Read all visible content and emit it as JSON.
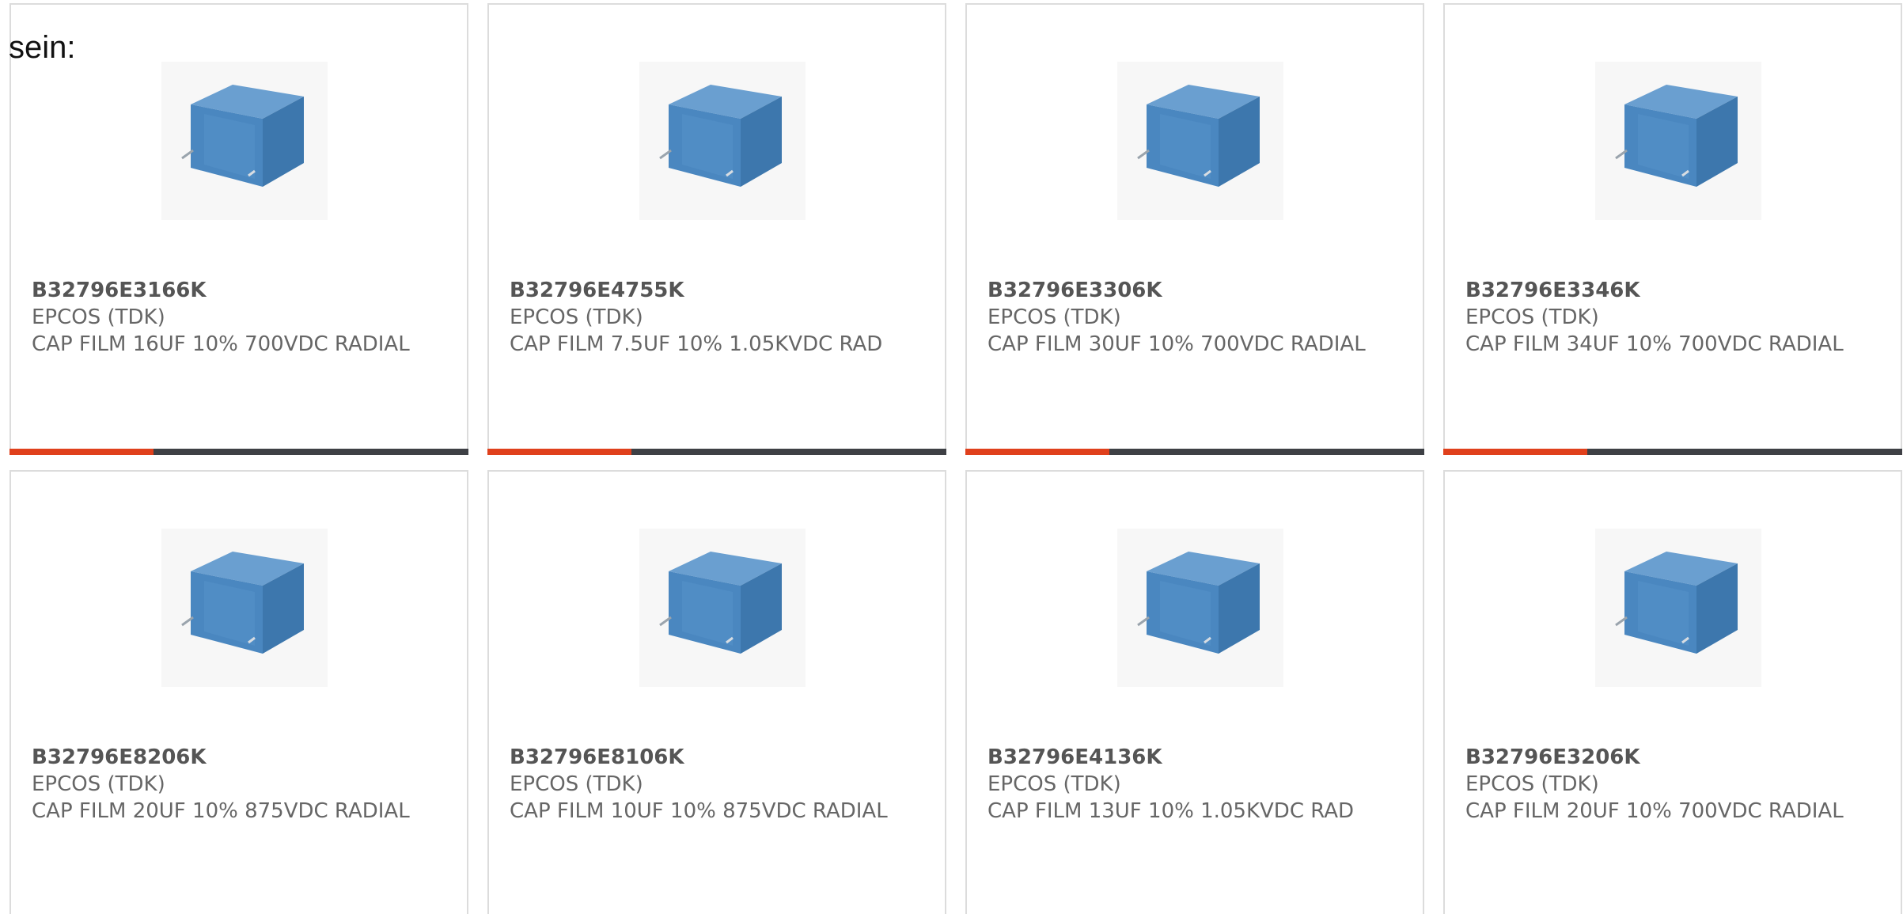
{
  "intro_text": "sein:",
  "colors": {
    "accent": "#e0401c",
    "bar": "#3e4045",
    "capacitor": "#4a87c0"
  },
  "products": [
    {
      "part_number": "B32796E3166K",
      "manufacturer": "EPCOS (TDK)",
      "description": "CAP FILM 16UF 10% 700VDC RADIAL",
      "image_icon": "film-capacitor-icon"
    },
    {
      "part_number": "B32796E4755K",
      "manufacturer": "EPCOS (TDK)",
      "description": "CAP FILM 7.5UF 10% 1.05KVDC RAD",
      "image_icon": "film-capacitor-icon"
    },
    {
      "part_number": "B32796E3306K",
      "manufacturer": "EPCOS (TDK)",
      "description": "CAP FILM 30UF 10% 700VDC RADIAL",
      "image_icon": "film-capacitor-icon"
    },
    {
      "part_number": "B32796E3346K",
      "manufacturer": "EPCOS (TDK)",
      "description": "CAP FILM 34UF 10% 700VDC RADIAL",
      "image_icon": "film-capacitor-icon"
    },
    {
      "part_number": "B32796E8206K",
      "manufacturer": "EPCOS (TDK)",
      "description": "CAP FILM 20UF 10% 875VDC RADIAL",
      "image_icon": "film-capacitor-icon"
    },
    {
      "part_number": "B32796E8106K",
      "manufacturer": "EPCOS (TDK)",
      "description": "CAP FILM 10UF 10% 875VDC RADIAL",
      "image_icon": "film-capacitor-icon"
    },
    {
      "part_number": "B32796E4136K",
      "manufacturer": "EPCOS (TDK)",
      "description": "CAP FILM 13UF 10% 1.05KVDC RAD",
      "image_icon": "film-capacitor-icon"
    },
    {
      "part_number": "B32796E3206K",
      "manufacturer": "EPCOS (TDK)",
      "description": "CAP FILM 20UF 10% 700VDC RADIAL",
      "image_icon": "film-capacitor-icon"
    }
  ]
}
